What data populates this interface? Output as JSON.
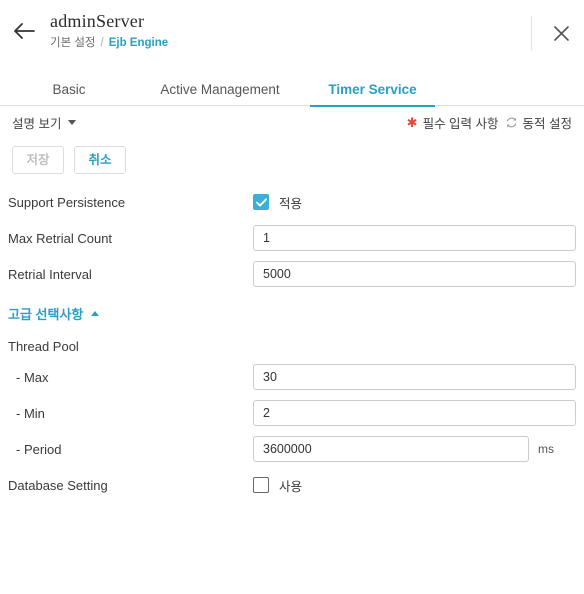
{
  "header": {
    "title": "adminServer",
    "breadcrumb": {
      "root": "기본 설정",
      "separator": "/",
      "current": "Ejb Engine"
    },
    "back_icon": "arrow-left-icon",
    "close_icon": "close-icon"
  },
  "tabs": [
    {
      "label": "Basic",
      "selected": false
    },
    {
      "label": "Active Management",
      "selected": false
    },
    {
      "label": "Timer Service",
      "selected": true
    }
  ],
  "subbar": {
    "description_toggle": "설명 보기",
    "required_legend": "필수 입력 사항",
    "required_marker": "✱",
    "dynamic_legend": "동적 설정",
    "dynamic_icon": "refresh-icon"
  },
  "actions": {
    "save_label": "저장",
    "cancel_label": "취소"
  },
  "form": {
    "support_persistence": {
      "label": "Support Persistence",
      "checkbox_label": "적용",
      "checked": true
    },
    "max_retrial_count": {
      "label": "Max Retrial Count",
      "value": "1"
    },
    "retrial_interval": {
      "label": "Retrial Interval",
      "value": "5000"
    },
    "advanced_section": {
      "title": "고급 선택사항",
      "expanded": true
    },
    "thread_pool": {
      "label": "Thread Pool",
      "max": {
        "label": "- Max",
        "value": "30"
      },
      "min": {
        "label": "- Min",
        "value": "2"
      },
      "period": {
        "label": "- Period",
        "value": "3600000",
        "unit": "ms"
      }
    },
    "database_setting": {
      "label": "Database Setting",
      "checkbox_label": "사용",
      "checked": false
    }
  },
  "colors": {
    "accent": "#2a9fc4",
    "checkbox_on": "#3ab0d8",
    "required": "#e8453c",
    "text": "#333333"
  }
}
